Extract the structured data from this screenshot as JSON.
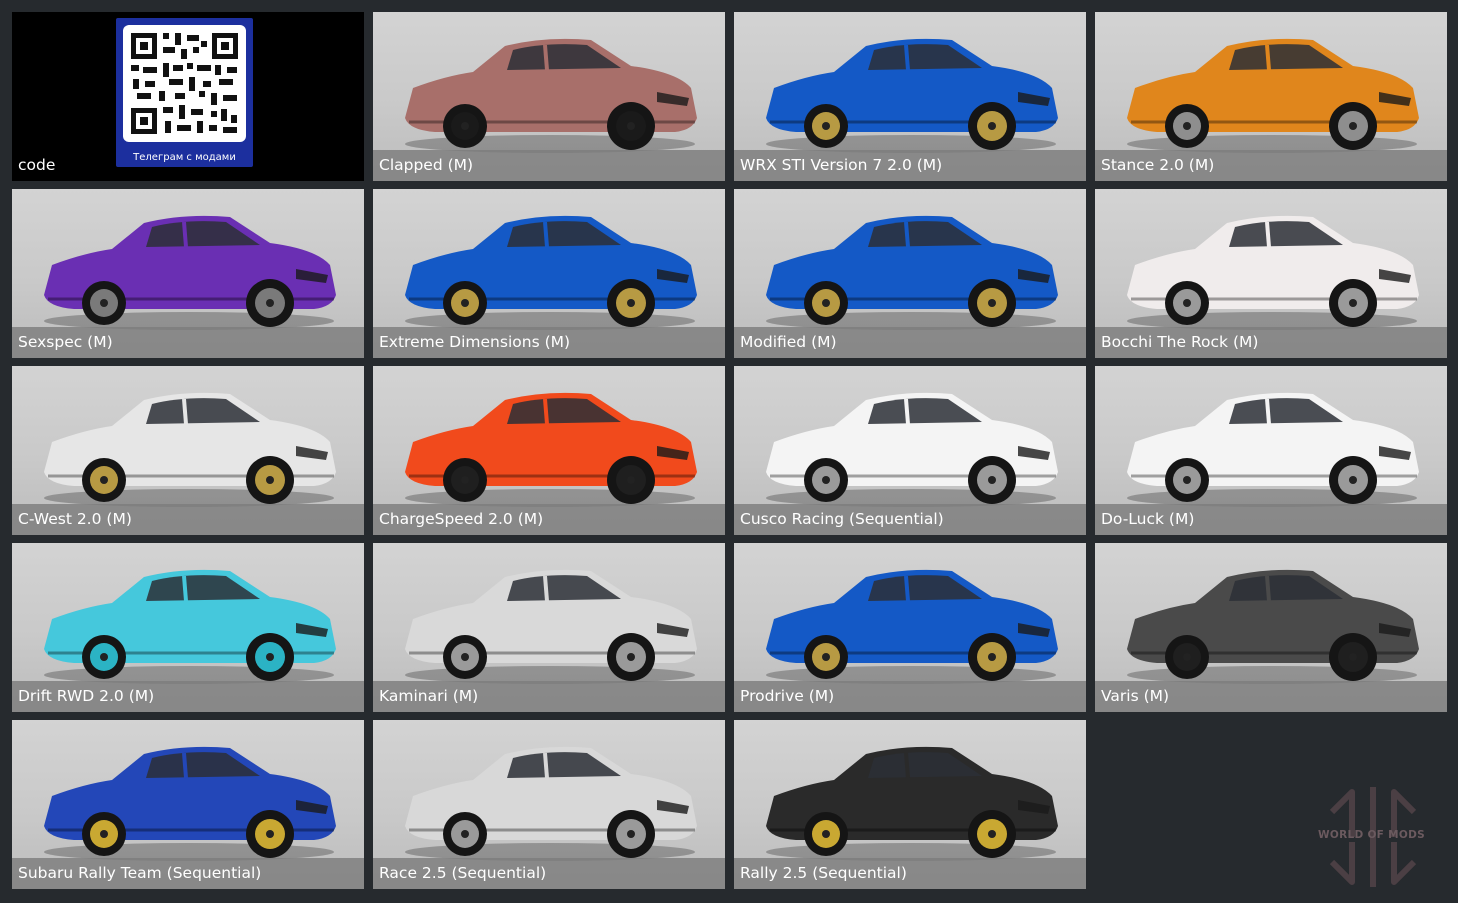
{
  "qr": {
    "caption": "code",
    "label": "Телеграм с модами"
  },
  "tiles": [
    {
      "label": "Clapped (M)",
      "body": "#a86f6a",
      "wheel": "#1a1a1a"
    },
    {
      "label": "WRX STI Version 7 2.0 (M)",
      "body": "#1459c6",
      "wheel": "#b79a43"
    },
    {
      "label": "Stance 2.0 (M)",
      "body": "#e0861c",
      "wheel": "#8e8e8e"
    },
    {
      "label": "Sexspec (M)",
      "body": "#6a2fb3",
      "wheel": "#7a7a7a"
    },
    {
      "label": "Extreme Dimensions (M)",
      "body": "#1459c6",
      "wheel": "#b79a43"
    },
    {
      "label": "Modified (M)",
      "body": "#1459c6",
      "wheel": "#b79a43"
    },
    {
      "label": "Bocchi The Rock (M)",
      "body": "#f0ecec",
      "wheel": "#9a9a9a"
    },
    {
      "label": "C-West 2.0 (M)",
      "body": "#e6e6e6",
      "wheel": "#b79a43"
    },
    {
      "label": "ChargeSpeed 2.0 (M)",
      "body": "#f14a1c",
      "wheel": "#1f1f1f"
    },
    {
      "label": "Cusco Racing (Sequential)",
      "body": "#f4f4f4",
      "wheel": "#9a9a9a"
    },
    {
      "label": "Do-Luck (M)",
      "body": "#f4f4f4",
      "wheel": "#9a9a9a"
    },
    {
      "label": "Drift RWD 2.0 (M)",
      "body": "#45c8dc",
      "wheel": "#2bb3c4"
    },
    {
      "label": "Kaminari (M)",
      "body": "#d9d9d9",
      "wheel": "#9a9a9a"
    },
    {
      "label": "Prodrive (M)",
      "body": "#1459c6",
      "wheel": "#b79a43"
    },
    {
      "label": "Varis (M)",
      "body": "#4a4a4a",
      "wheel": "#1f1f1f"
    },
    {
      "label": "Subaru Rally Team (Sequential)",
      "body": "#2347b8",
      "wheel": "#c9a832"
    },
    {
      "label": "Race 2.5 (Sequential)",
      "body": "#d8d8d8",
      "wheel": "#9a9a9a"
    },
    {
      "label": "Rally 2.5 (Sequential)",
      "body": "#2a2a2a",
      "wheel": "#c9a832"
    }
  ],
  "watermark": {
    "text": "WORLD OF MODS"
  }
}
